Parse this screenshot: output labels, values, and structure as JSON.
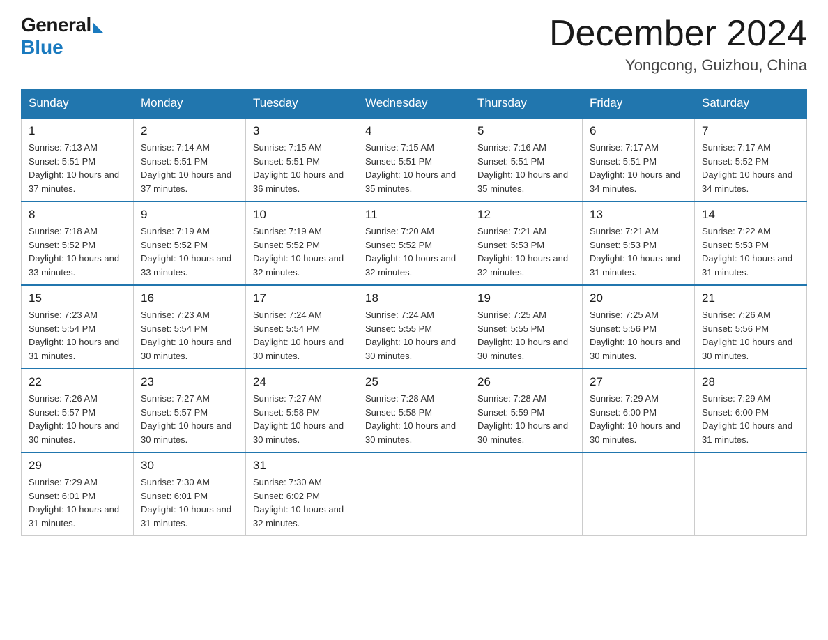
{
  "header": {
    "logo_general": "General",
    "logo_blue": "Blue",
    "month_title": "December 2024",
    "location": "Yongcong, Guizhou, China"
  },
  "weekdays": [
    "Sunday",
    "Monday",
    "Tuesday",
    "Wednesday",
    "Thursday",
    "Friday",
    "Saturday"
  ],
  "weeks": [
    [
      {
        "day": "1",
        "sunrise": "7:13 AM",
        "sunset": "5:51 PM",
        "daylight": "10 hours and 37 minutes."
      },
      {
        "day": "2",
        "sunrise": "7:14 AM",
        "sunset": "5:51 PM",
        "daylight": "10 hours and 37 minutes."
      },
      {
        "day": "3",
        "sunrise": "7:15 AM",
        "sunset": "5:51 PM",
        "daylight": "10 hours and 36 minutes."
      },
      {
        "day": "4",
        "sunrise": "7:15 AM",
        "sunset": "5:51 PM",
        "daylight": "10 hours and 35 minutes."
      },
      {
        "day": "5",
        "sunrise": "7:16 AM",
        "sunset": "5:51 PM",
        "daylight": "10 hours and 35 minutes."
      },
      {
        "day": "6",
        "sunrise": "7:17 AM",
        "sunset": "5:51 PM",
        "daylight": "10 hours and 34 minutes."
      },
      {
        "day": "7",
        "sunrise": "7:17 AM",
        "sunset": "5:52 PM",
        "daylight": "10 hours and 34 minutes."
      }
    ],
    [
      {
        "day": "8",
        "sunrise": "7:18 AM",
        "sunset": "5:52 PM",
        "daylight": "10 hours and 33 minutes."
      },
      {
        "day": "9",
        "sunrise": "7:19 AM",
        "sunset": "5:52 PM",
        "daylight": "10 hours and 33 minutes."
      },
      {
        "day": "10",
        "sunrise": "7:19 AM",
        "sunset": "5:52 PM",
        "daylight": "10 hours and 32 minutes."
      },
      {
        "day": "11",
        "sunrise": "7:20 AM",
        "sunset": "5:52 PM",
        "daylight": "10 hours and 32 minutes."
      },
      {
        "day": "12",
        "sunrise": "7:21 AM",
        "sunset": "5:53 PM",
        "daylight": "10 hours and 32 minutes."
      },
      {
        "day": "13",
        "sunrise": "7:21 AM",
        "sunset": "5:53 PM",
        "daylight": "10 hours and 31 minutes."
      },
      {
        "day": "14",
        "sunrise": "7:22 AM",
        "sunset": "5:53 PM",
        "daylight": "10 hours and 31 minutes."
      }
    ],
    [
      {
        "day": "15",
        "sunrise": "7:23 AM",
        "sunset": "5:54 PM",
        "daylight": "10 hours and 31 minutes."
      },
      {
        "day": "16",
        "sunrise": "7:23 AM",
        "sunset": "5:54 PM",
        "daylight": "10 hours and 30 minutes."
      },
      {
        "day": "17",
        "sunrise": "7:24 AM",
        "sunset": "5:54 PM",
        "daylight": "10 hours and 30 minutes."
      },
      {
        "day": "18",
        "sunrise": "7:24 AM",
        "sunset": "5:55 PM",
        "daylight": "10 hours and 30 minutes."
      },
      {
        "day": "19",
        "sunrise": "7:25 AM",
        "sunset": "5:55 PM",
        "daylight": "10 hours and 30 minutes."
      },
      {
        "day": "20",
        "sunrise": "7:25 AM",
        "sunset": "5:56 PM",
        "daylight": "10 hours and 30 minutes."
      },
      {
        "day": "21",
        "sunrise": "7:26 AM",
        "sunset": "5:56 PM",
        "daylight": "10 hours and 30 minutes."
      }
    ],
    [
      {
        "day": "22",
        "sunrise": "7:26 AM",
        "sunset": "5:57 PM",
        "daylight": "10 hours and 30 minutes."
      },
      {
        "day": "23",
        "sunrise": "7:27 AM",
        "sunset": "5:57 PM",
        "daylight": "10 hours and 30 minutes."
      },
      {
        "day": "24",
        "sunrise": "7:27 AM",
        "sunset": "5:58 PM",
        "daylight": "10 hours and 30 minutes."
      },
      {
        "day": "25",
        "sunrise": "7:28 AM",
        "sunset": "5:58 PM",
        "daylight": "10 hours and 30 minutes."
      },
      {
        "day": "26",
        "sunrise": "7:28 AM",
        "sunset": "5:59 PM",
        "daylight": "10 hours and 30 minutes."
      },
      {
        "day": "27",
        "sunrise": "7:29 AM",
        "sunset": "6:00 PM",
        "daylight": "10 hours and 30 minutes."
      },
      {
        "day": "28",
        "sunrise": "7:29 AM",
        "sunset": "6:00 PM",
        "daylight": "10 hours and 31 minutes."
      }
    ],
    [
      {
        "day": "29",
        "sunrise": "7:29 AM",
        "sunset": "6:01 PM",
        "daylight": "10 hours and 31 minutes."
      },
      {
        "day": "30",
        "sunrise": "7:30 AM",
        "sunset": "6:01 PM",
        "daylight": "10 hours and 31 minutes."
      },
      {
        "day": "31",
        "sunrise": "7:30 AM",
        "sunset": "6:02 PM",
        "daylight": "10 hours and 32 minutes."
      },
      null,
      null,
      null,
      null
    ]
  ]
}
